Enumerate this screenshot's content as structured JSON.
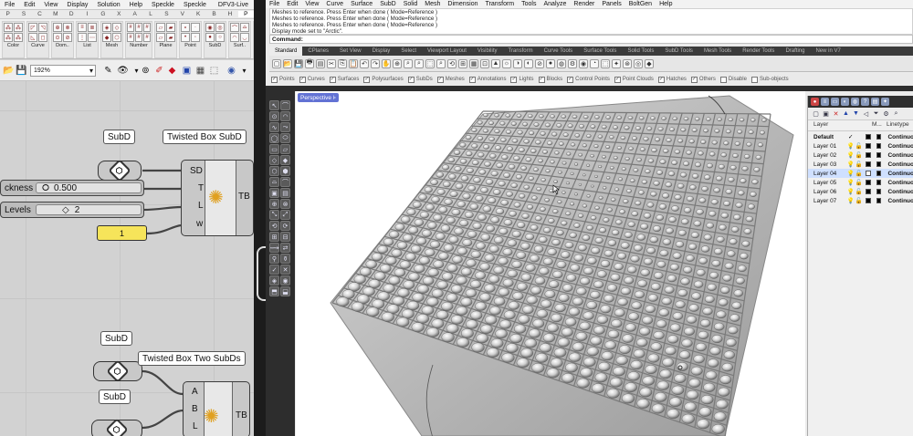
{
  "gh": {
    "menu": [
      "File",
      "Edit",
      "View",
      "Display",
      "Solution",
      "Help",
      "Speckle",
      "Speckle"
    ],
    "doc_title": "DFV3-Live",
    "tabs": [
      "P",
      "S",
      "C",
      "M",
      "D",
      "I",
      "G",
      "X",
      "A",
      "L",
      "S",
      "V",
      "K",
      "B",
      "H",
      "P"
    ],
    "ribbon_groups": [
      {
        "label": "Color",
        "icons": [
          "⁂",
          "⁂",
          "⁂",
          "⁂"
        ]
      },
      {
        "label": "Curve",
        "icons": [
          "◸",
          "◹",
          "◺",
          "◻"
        ]
      },
      {
        "label": "Dom..",
        "icons": [
          "⊕",
          "⊗",
          "⊙",
          "⊘"
        ]
      },
      {
        "label": "List",
        "icons": [
          "≡",
          "≣",
          "⋮",
          "⋯"
        ]
      },
      {
        "label": "Mesh",
        "icons": [
          "◈",
          "◇",
          "◆",
          "⬡"
        ]
      },
      {
        "label": "Number",
        "icons": [
          "#",
          "#",
          "#",
          "#",
          "#",
          "#"
        ]
      },
      {
        "label": "Plane",
        "icons": [
          "▱",
          "▰",
          "▱",
          "▰"
        ]
      },
      {
        "label": "Point",
        "icons": [
          "∘",
          "∙",
          "•",
          "◦"
        ]
      },
      {
        "label": "SubD",
        "icons": [
          "◉",
          "◎",
          "●",
          "○"
        ]
      },
      {
        "label": "Surf..",
        "icons": [
          "⌒",
          "⌓",
          "◠",
          "◡"
        ]
      },
      {
        "label": "Tran..",
        "icons": [
          "↻",
          "↺",
          "⤾",
          "⤿"
        ]
      },
      {
        "label": "Twis..",
        "icons": [
          "⟲",
          "⟳",
          "⥀",
          "⥁"
        ]
      },
      {
        "label": "Vecto..",
        "icons": [
          "↗",
          "↘",
          "↙",
          "↖"
        ]
      }
    ],
    "zoom": "192%",
    "components": {
      "subd_top_balloon": "SubD",
      "subd_top_icon": "⬡",
      "twisted_box_subd": {
        "title": "Twisted Box SubD",
        "inputs": [
          "SD",
          "T",
          "L",
          "w"
        ],
        "output": "TB"
      },
      "thickness": {
        "label": "ckness",
        "value": "0.500"
      },
      "levels": {
        "label": "Levels",
        "value": "2"
      },
      "panel_value": "1",
      "subd_mid_balloon": "SubD",
      "subd_mid_icon": "⬡",
      "twisted_box_two": {
        "title": "Twisted Box Two SubDs",
        "inputs": [
          "A",
          "B",
          "L"
        ],
        "output": "TB"
      },
      "subd_bot_balloon": "SubD",
      "subd_bot_icon": "⬡"
    }
  },
  "rhino": {
    "menu": [
      "File",
      "Edit",
      "View",
      "Curve",
      "Surface",
      "SubD",
      "Solid",
      "Mesh",
      "Dimension",
      "Transform",
      "Tools",
      "Analyze",
      "Render",
      "Panels",
      "BoltGen",
      "Help"
    ],
    "history": [
      "Meshes to reference. Press Enter when done ( Mode=Reference )",
      "Meshes to reference. Press Enter when done ( Mode=Reference )",
      "Meshes to reference. Press Enter when done ( Mode=Reference )",
      "Display mode set to \"Arctic\"."
    ],
    "command_label": "Command:",
    "tabs": [
      "Standard",
      "CPlanes",
      "Set View",
      "Display",
      "Select",
      "Viewport Layout",
      "Visibility",
      "Transform",
      "Curve Tools",
      "Surface Tools",
      "Solid Tools",
      "SubD Tools",
      "Mesh Tools",
      "Render Tools",
      "Drafting",
      "New in V7"
    ],
    "osnaps": [
      "Points",
      "Curves",
      "Surfaces",
      "Polysurfaces",
      "SubDs",
      "Meshes",
      "Annotations",
      "Lights",
      "Blocks",
      "Control Points",
      "Point Clouds",
      "Hatches",
      "Others",
      "Disable",
      "Sub-objects"
    ],
    "viewport_label": "Perspective",
    "layers": {
      "header": {
        "name": "Layer",
        "m": "M...",
        "linetype": "Linetype"
      },
      "rows": [
        {
          "name": "Default",
          "check": "✓",
          "linetype": "Continuo",
          "bold": true
        },
        {
          "name": "Layer 01",
          "check": "",
          "linetype": "Continuo"
        },
        {
          "name": "Layer 02",
          "check": "",
          "linetype": "Continuo"
        },
        {
          "name": "Layer 03",
          "check": "",
          "linetype": "Continuo"
        },
        {
          "name": "Layer 04",
          "check": "",
          "linetype": "Continuo",
          "selected": true
        },
        {
          "name": "Layer 05",
          "check": "",
          "linetype": "Continuo"
        },
        {
          "name": "Layer 06",
          "check": "",
          "linetype": "Continuo"
        },
        {
          "name": "Layer 07",
          "check": "",
          "linetype": "Continuo"
        }
      ]
    }
  }
}
